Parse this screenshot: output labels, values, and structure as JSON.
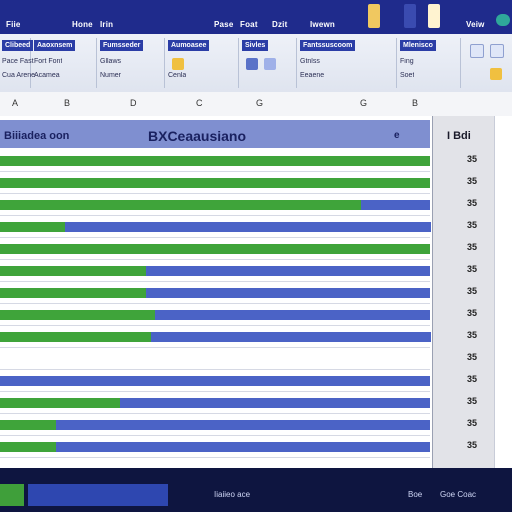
{
  "app": {
    "tabs": [
      "Fiie",
      "Hone",
      "Irin",
      "Pase",
      "Foat",
      "Dzit",
      "Iwewn",
      "Veiw"
    ]
  },
  "ribbon": {
    "groups": [
      {
        "title": "Clibeed",
        "cmds": [
          "Pace Fast",
          "Cua Arene"
        ]
      },
      {
        "title": "Aaoxnsem",
        "cmds": [
          "Fort Font",
          "Acamea"
        ]
      },
      {
        "title": "Fumsseder",
        "cmds": [
          "Gllaws",
          "Numer"
        ]
      },
      {
        "title": "Aumoasee",
        "cmds": [
          "Sivles",
          "Cenla"
        ]
      },
      {
        "title": "Fantssuscoom",
        "cmds": [
          "Gtnlss",
          "Eeaene"
        ]
      },
      {
        "title": "Mlenisco",
        "cmds": [
          "Fing",
          "Soet"
        ]
      }
    ]
  },
  "columns": [
    "A",
    "B",
    "D",
    "C",
    "G",
    "G",
    "B"
  ],
  "grid": {
    "subtitle": "Biiiadea oon",
    "title": "BXCeaausiano",
    "col_label": "e"
  },
  "rows": [
    {
      "green": 1.0,
      "blue": 0.0,
      "value": "35"
    },
    {
      "green": 1.0,
      "blue": 0.0,
      "value": "35"
    },
    {
      "green": 0.84,
      "blue": 0.16,
      "value": "35"
    },
    {
      "green": 0.15,
      "blue": 0.85,
      "value": "35"
    },
    {
      "green": 1.0,
      "blue": 0.0,
      "value": "35"
    },
    {
      "green": 0.34,
      "blue": 0.66,
      "value": "35"
    },
    {
      "green": 0.34,
      "blue": 0.66,
      "value": "35"
    },
    {
      "green": 0.36,
      "blue": 0.64,
      "value": "35"
    },
    {
      "green": 0.35,
      "blue": 0.65,
      "value": "35"
    },
    {
      "green": 0.0,
      "blue": 0.0,
      "value": "35"
    },
    {
      "green": 0.0,
      "blue": 1.0,
      "value": "35"
    },
    {
      "green": 0.28,
      "blue": 0.72,
      "value": "35"
    },
    {
      "green": 0.13,
      "blue": 0.87,
      "value": "35"
    },
    {
      "green": 0.13,
      "blue": 0.87,
      "value": "35"
    }
  ],
  "right_pane": {
    "header": "I Bdi"
  },
  "status": {
    "left": "Iiaiieo ace",
    "mid": "Boe",
    "right": "Goe Coac"
  },
  "colors": {
    "titlebar": "#1f2b8c",
    "green": "#3fa43a",
    "blue": "#4b63c6",
    "status": "#0e1540"
  }
}
